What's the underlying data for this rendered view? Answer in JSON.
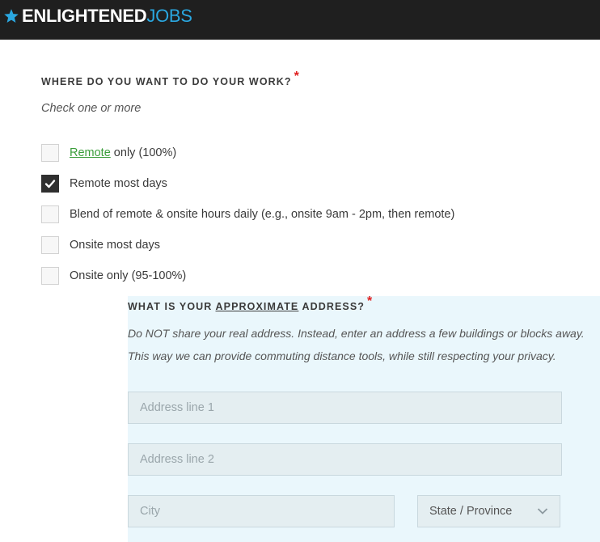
{
  "header": {
    "logo_part1": "ENLIGHTENED",
    "logo_part2": "JOBS",
    "brand_color": "#2aa7e0",
    "bar_color": "#1f1f1f"
  },
  "work_question": {
    "title": "WHERE DO YOU WANT TO DO YOUR WORK?",
    "required_mark": "*",
    "hint": "Check one or more",
    "options": [
      {
        "link_text": "Remote",
        "label": " only (100%)",
        "checked": false
      },
      {
        "label": "Remote most days",
        "checked": true
      },
      {
        "label": "Blend of remote & onsite hours daily (e.g., onsite 9am - 2pm, then remote)",
        "checked": false
      },
      {
        "label": "Onsite most days",
        "checked": false
      },
      {
        "label": "Onsite only (95-100%)",
        "checked": false
      }
    ]
  },
  "address_question": {
    "title_pre": "WHAT IS YOUR ",
    "title_emph": "APPROXIMATE",
    "title_post": " ADDRESS?",
    "required_mark": "*",
    "hint_line1": "Do NOT share your real address. Instead, enter an address a few buildings or blocks away.",
    "hint_line2": "This way we can provide commuting distance tools, while still respecting your privacy.",
    "address1_placeholder": "Address line 1",
    "address2_placeholder": "Address line 2",
    "city_placeholder": "City",
    "state_selected": "State / Province",
    "panel_color": "#eaf7fc"
  }
}
